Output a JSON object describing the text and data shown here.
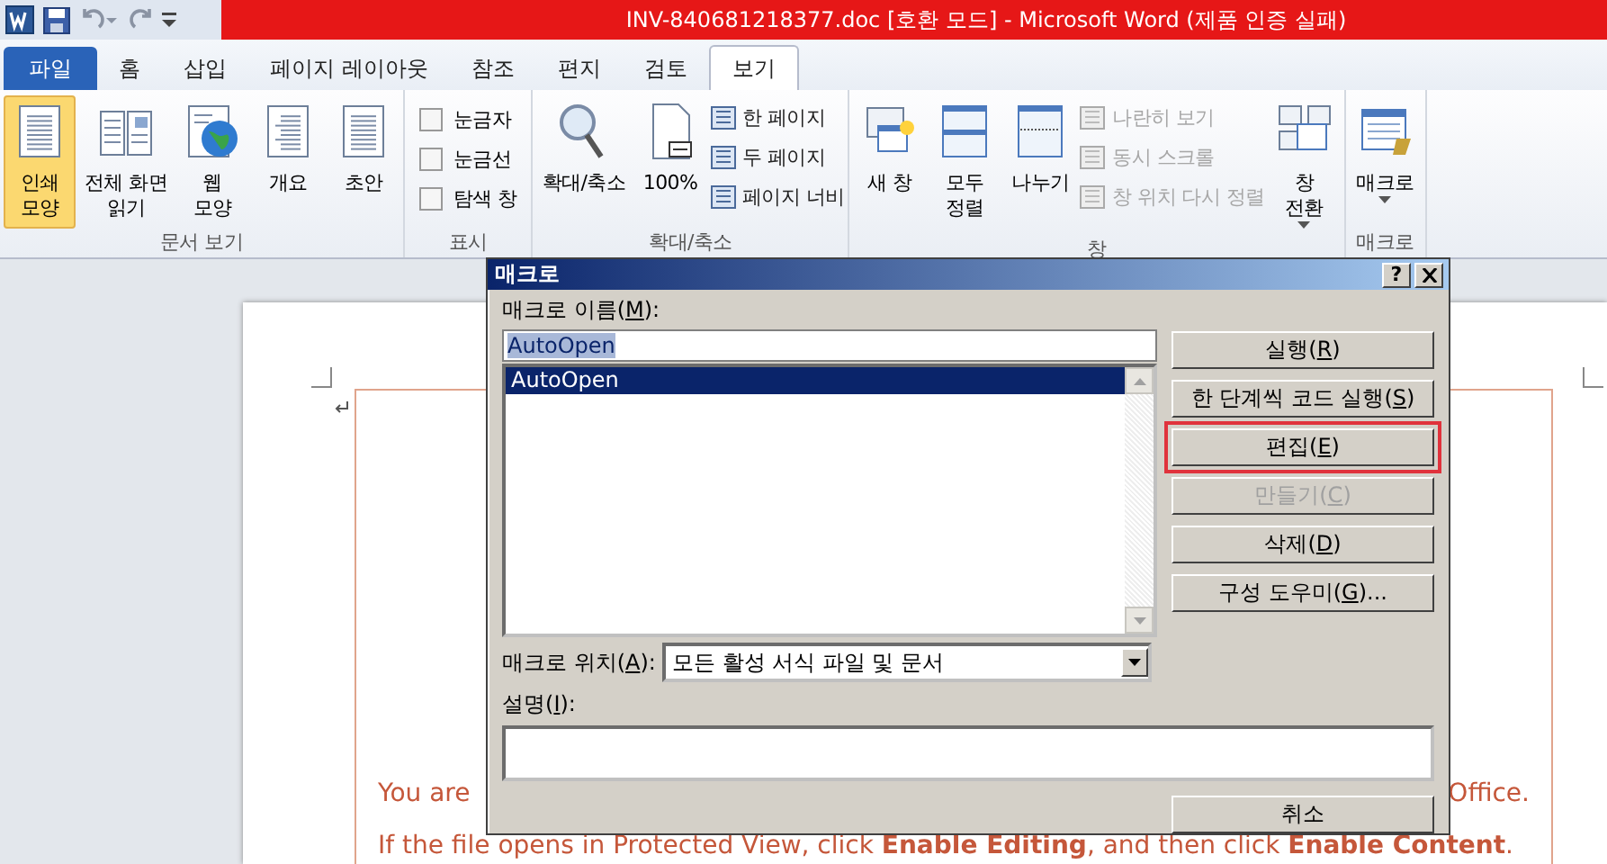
{
  "title_bar": {
    "title": "INV-840681218377.doc [호환 모드] - Microsoft Word (제품 인증 실패)"
  },
  "tabs": [
    {
      "label": "파일",
      "kind": "file",
      "selected": false
    },
    {
      "label": "홈",
      "kind": "tab",
      "selected": false
    },
    {
      "label": "삽입",
      "kind": "tab",
      "selected": false
    },
    {
      "label": "페이지 레이아웃",
      "kind": "tab",
      "selected": false
    },
    {
      "label": "참조",
      "kind": "tab",
      "selected": false
    },
    {
      "label": "편지",
      "kind": "tab",
      "selected": false
    },
    {
      "label": "검토",
      "kind": "tab",
      "selected": false
    },
    {
      "label": "보기",
      "kind": "tab",
      "selected": true
    }
  ],
  "ribbon": {
    "groups": [
      {
        "label": "문서 보기",
        "items": [
          {
            "kind": "large",
            "lines": [
              "인쇄",
              "모양"
            ],
            "selected": true
          },
          {
            "kind": "large",
            "lines": [
              "전체 화면",
              "읽기"
            ],
            "selected": false
          },
          {
            "kind": "large",
            "lines": [
              "웹",
              "모양"
            ],
            "selected": false
          },
          {
            "kind": "large",
            "lines": [
              "개요"
            ],
            "selected": false
          },
          {
            "kind": "large",
            "lines": [
              "초안"
            ],
            "selected": false
          }
        ]
      },
      {
        "label": "표시",
        "items": [
          {
            "kind": "check",
            "label": "눈금자",
            "checked": false
          },
          {
            "kind": "check",
            "label": "눈금선",
            "checked": false
          },
          {
            "kind": "check",
            "label": "탐색 창",
            "checked": false
          }
        ]
      },
      {
        "label": "확대/축소",
        "items": [
          {
            "kind": "large",
            "lines": [
              "확대/축소"
            ],
            "selected": false
          },
          {
            "kind": "large",
            "lines": [
              "100%"
            ],
            "selected": false
          },
          {
            "kind": "small",
            "label": "한 페이지",
            "disabled": false
          },
          {
            "kind": "small",
            "label": "두 페이지",
            "disabled": false
          },
          {
            "kind": "small",
            "label": "페이지 너비",
            "disabled": false
          }
        ]
      },
      {
        "label": "창",
        "items": [
          {
            "kind": "large",
            "lines": [
              "새 창"
            ],
            "selected": false
          },
          {
            "kind": "large",
            "lines": [
              "모두",
              "정렬"
            ],
            "selected": false
          },
          {
            "kind": "large",
            "lines": [
              "나누기"
            ],
            "selected": false
          },
          {
            "kind": "small",
            "label": "나란히 보기",
            "disabled": true
          },
          {
            "kind": "small",
            "label": "동시 스크롤",
            "disabled": true
          },
          {
            "kind": "small",
            "label": "창 위치 다시 정렬",
            "disabled": true
          },
          {
            "kind": "large",
            "lines": [
              "창",
              "전환"
            ],
            "selected": false,
            "dropdown": true
          }
        ]
      },
      {
        "label": "매크로",
        "items": [
          {
            "kind": "large",
            "lines": [
              "매크로"
            ],
            "selected": false,
            "dropdown": true
          }
        ]
      }
    ]
  },
  "document": {
    "lines": [
      {
        "left": "You are",
        "right": "Office."
      },
      {
        "text": "If the file opens in Protected View, click **Enable Editing**, and then click **Enable Content**."
      }
    ]
  },
  "dialog": {
    "title": "매크로",
    "help": "?",
    "name_label": [
      "매크로 이름(",
      "M",
      "):"
    ],
    "name_value": "AutoOpen",
    "macros": [
      {
        "label": "AutoOpen",
        "selected": true
      }
    ],
    "buttons": [
      {
        "label": [
          "실행(",
          "R",
          ")"
        ],
        "disabled": false,
        "highlighted": false
      },
      {
        "label": [
          "한 단계씩 코드 실행(",
          "S",
          ")"
        ],
        "disabled": false,
        "highlighted": false
      },
      {
        "label": [
          "편집(",
          "E",
          ")"
        ],
        "disabled": false,
        "highlighted": true
      },
      {
        "label": [
          "만들기(",
          "C",
          ")"
        ],
        "disabled": true,
        "highlighted": false
      },
      {
        "label": [
          "삭제(",
          "D",
          ")"
        ],
        "disabled": false,
        "highlighted": false
      },
      {
        "label": [
          "구성 도우미(",
          "G",
          ")..."
        ],
        "disabled": false,
        "highlighted": false
      }
    ],
    "location_label": [
      "매크로 위치(",
      "A",
      "):"
    ],
    "location_value": "모든 활성 서식 파일 및 문서",
    "description_label": [
      "설명(",
      "I",
      "):"
    ],
    "cancel": "취소"
  }
}
